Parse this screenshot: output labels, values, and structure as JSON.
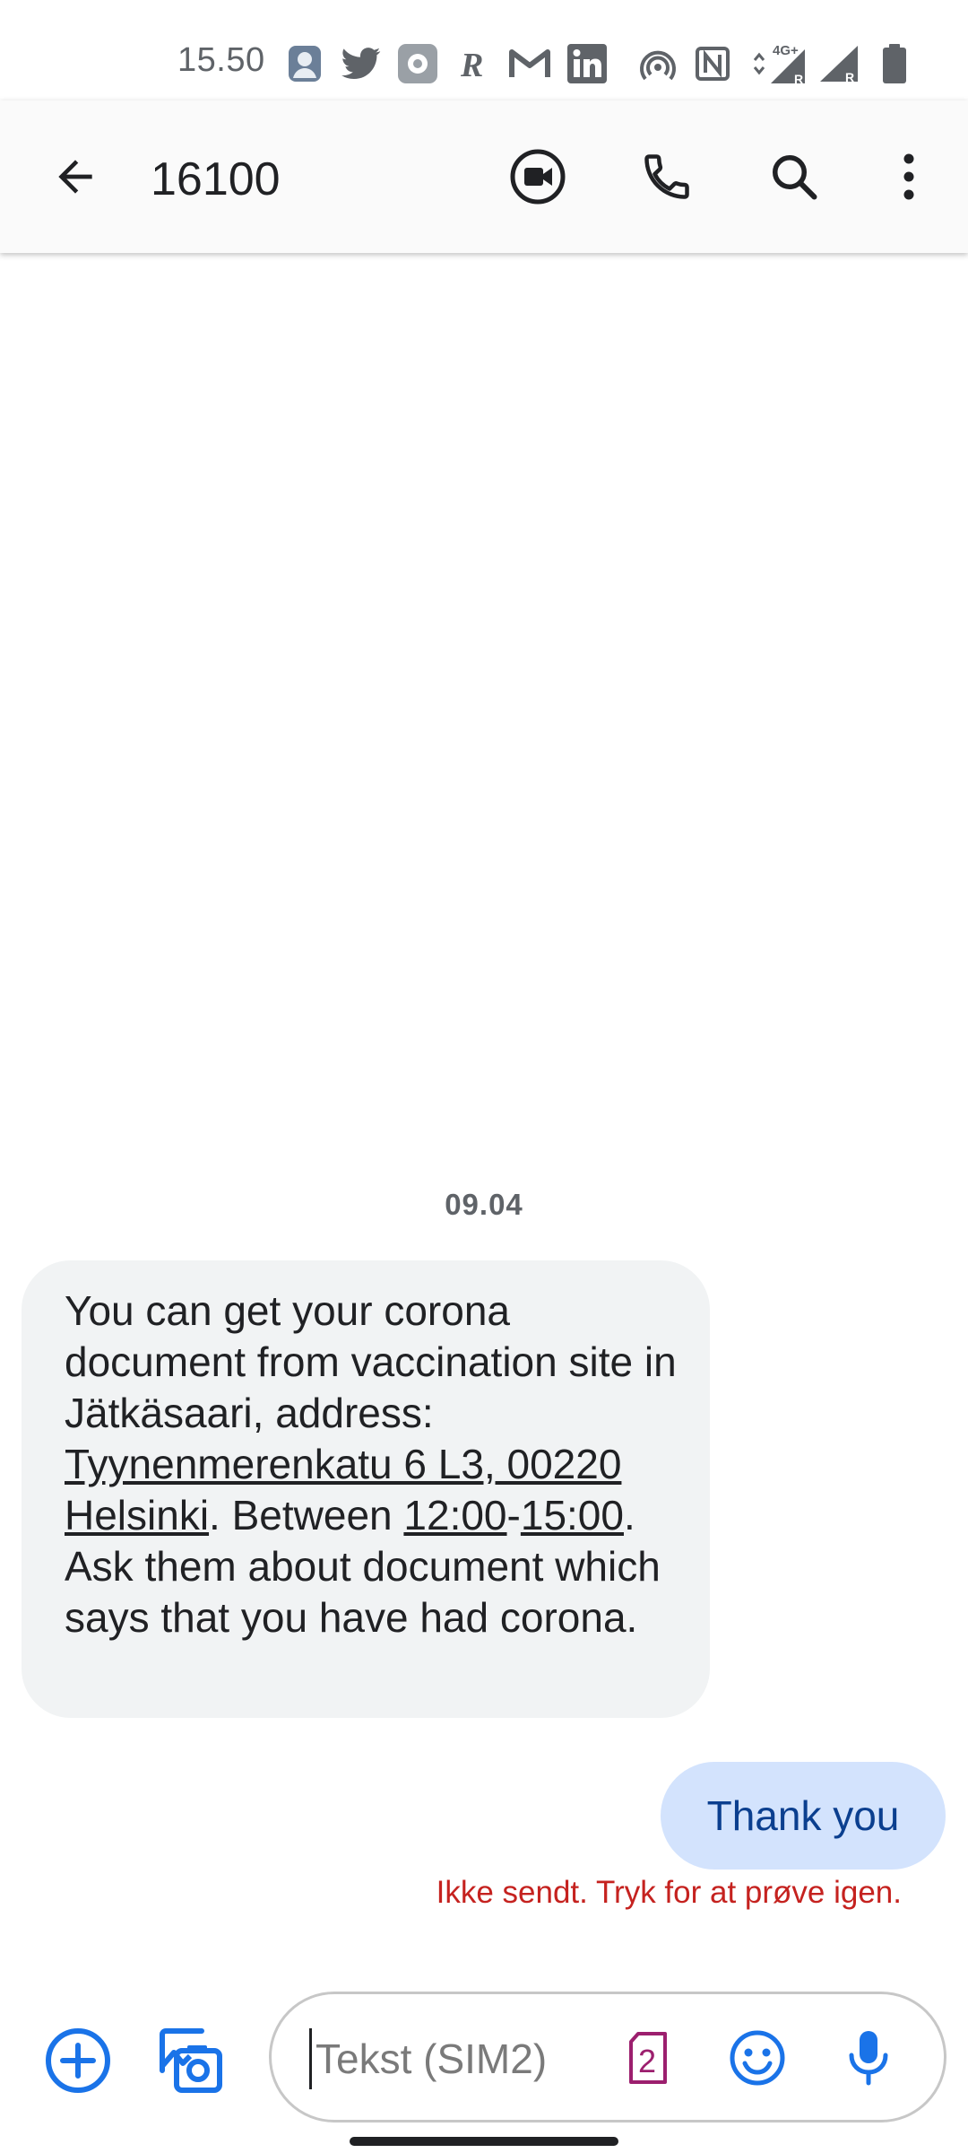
{
  "status_bar": {
    "time": "15.50",
    "icons": [
      "account-icon",
      "twitter-icon",
      "settings-app-icon",
      "r-app-icon",
      "gmail-icon",
      "linkedin-icon",
      "hotspot-icon",
      "nfc-icon",
      "4g-signal-icon",
      "signal-icon",
      "battery-icon"
    ],
    "network_label": "4G+"
  },
  "app_bar": {
    "title": "16100",
    "icons": [
      "back-arrow-icon",
      "video-call-icon",
      "phone-icon",
      "search-icon",
      "more-vert-icon"
    ]
  },
  "thread": {
    "date_separator": "09.04",
    "incoming": {
      "part1": "You can get your corona document from vaccination site in Jätkäsaari, address: ",
      "address_link": "Tyynenmerenkatu 6 L3, 00220 Helsinki",
      "part2": ". Between ",
      "time_start": "12:00",
      "dash": "-",
      "time_end": "15:00",
      "part3": ". Ask them about document which says that you have had corona."
    },
    "outgoing": {
      "text": "Thank you",
      "status": "Ikke sendt. Tryk for at prøve igen."
    }
  },
  "compose": {
    "placeholder": "Tekst (SIM2)",
    "sim_number": "2",
    "icons": [
      "add-circle-icon",
      "gallery-icon",
      "sim-card-icon",
      "emoji-icon",
      "microphone-icon"
    ]
  },
  "colors": {
    "accent": "#1a73e8",
    "incoming_bubble": "#f1f3f4",
    "outgoing_bubble": "#d3e3fd",
    "error": "#c5221f",
    "sim_purple": "#9c1f6e"
  }
}
